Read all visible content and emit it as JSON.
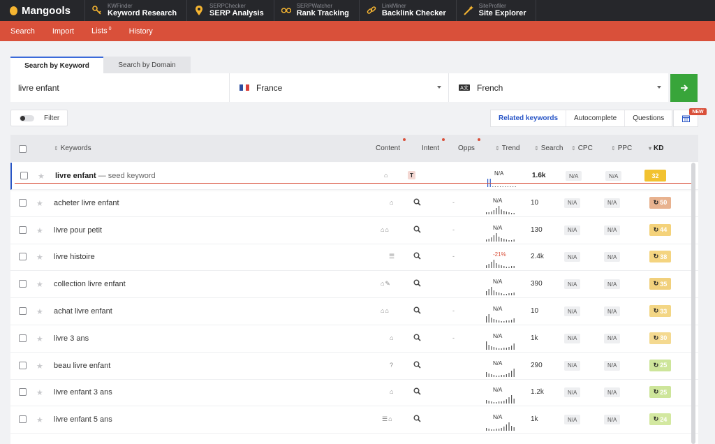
{
  "brand": {
    "name": "Mangools"
  },
  "tools": [
    {
      "sub": "KWFinder",
      "name": "Keyword Research",
      "icon": "key-icon"
    },
    {
      "sub": "SERPChecker",
      "name": "SERP Analysis",
      "icon": "pin-icon"
    },
    {
      "sub": "SERPWatcher",
      "name": "Rank Tracking",
      "icon": "glasses-icon"
    },
    {
      "sub": "LinkMiner",
      "name": "Backlink Checker",
      "icon": "link-icon"
    },
    {
      "sub": "SiteProfiler",
      "name": "Site Explorer",
      "icon": "wand-icon"
    }
  ],
  "subnav": {
    "search": "Search",
    "import": "Import",
    "lists": "Lists",
    "lists_count": "0",
    "history": "History"
  },
  "search_tabs": {
    "by_keyword": "Search by Keyword",
    "by_domain": "Search by Domain"
  },
  "search": {
    "keyword_value": "livre enfant",
    "location": "France",
    "language": "French",
    "language_icon_text": "A文"
  },
  "filter": {
    "label": "Filter"
  },
  "segments": {
    "related": "Related keywords",
    "autocomplete": "Autocomplete",
    "questions": "Questions"
  },
  "new_badge": "NEW",
  "columns": {
    "keywords": "Keywords",
    "content": "Content",
    "intent": "Intent",
    "opps": "Opps",
    "trend": "Trend",
    "search": "Search",
    "cpc": "CPC",
    "ppc": "PPC",
    "kd": "KD"
  },
  "rows": [
    {
      "keyword": "livre enfant",
      "seed_label": "— seed keyword",
      "content": "⌂",
      "trend": "N/A",
      "search": "1.6k",
      "cpc": "N/A",
      "ppc": "N/A",
      "kd": "32",
      "opps": ""
    },
    {
      "keyword": "acheter livre enfant",
      "content": "⌂",
      "trend": "N/A",
      "search": "10",
      "cpc": "N/A",
      "ppc": "N/A",
      "kd": "50",
      "opps": "-"
    },
    {
      "keyword": "livre pour petit",
      "content": "⌂⌂",
      "trend": "N/A",
      "search": "130",
      "cpc": "N/A",
      "ppc": "N/A",
      "kd": "44",
      "opps": "-"
    },
    {
      "keyword": "livre histoire",
      "content": "☰",
      "trend": "-21%",
      "search": "2.4k",
      "cpc": "N/A",
      "ppc": "N/A",
      "kd": "38",
      "opps": "-"
    },
    {
      "keyword": "collection livre enfant",
      "content": "⌂✎",
      "trend": "N/A",
      "search": "390",
      "cpc": "N/A",
      "ppc": "N/A",
      "kd": "35",
      "opps": ""
    },
    {
      "keyword": "achat livre enfant",
      "content": "⌂⌂",
      "trend": "N/A",
      "search": "10",
      "cpc": "N/A",
      "ppc": "N/A",
      "kd": "33",
      "opps": "-"
    },
    {
      "keyword": "livre 3 ans",
      "content": "⌂",
      "trend": "N/A",
      "search": "1k",
      "cpc": "N/A",
      "ppc": "N/A",
      "kd": "30",
      "opps": "-"
    },
    {
      "keyword": "beau livre enfant",
      "content": "?",
      "trend": "N/A",
      "search": "290",
      "cpc": "N/A",
      "ppc": "N/A",
      "kd": "25",
      "opps": ""
    },
    {
      "keyword": "livre enfant 3 ans",
      "content": "⌂",
      "trend": "N/A",
      "search": "1.2k",
      "cpc": "N/A",
      "ppc": "N/A",
      "kd": "25",
      "opps": ""
    },
    {
      "keyword": "livre enfant 5 ans",
      "content": "☰⌂",
      "trend": "N/A",
      "search": "1k",
      "cpc": "N/A",
      "ppc": "N/A",
      "kd": "24",
      "opps": ""
    }
  ],
  "colors": {
    "accent_red": "#d9503a",
    "go_green": "#38a53a",
    "link_blue": "#2855c6",
    "kd_seed": "#f2c230",
    "kd_50": "#e8b28f",
    "kd_44": "#f4d27a",
    "kd_38": "#f4d480",
    "kd_35": "#f1d07c",
    "kd_33": "#f3d685",
    "kd_30": "#f4d990",
    "kd_25": "#cde59a",
    "kd_24": "#d3e8a0"
  }
}
